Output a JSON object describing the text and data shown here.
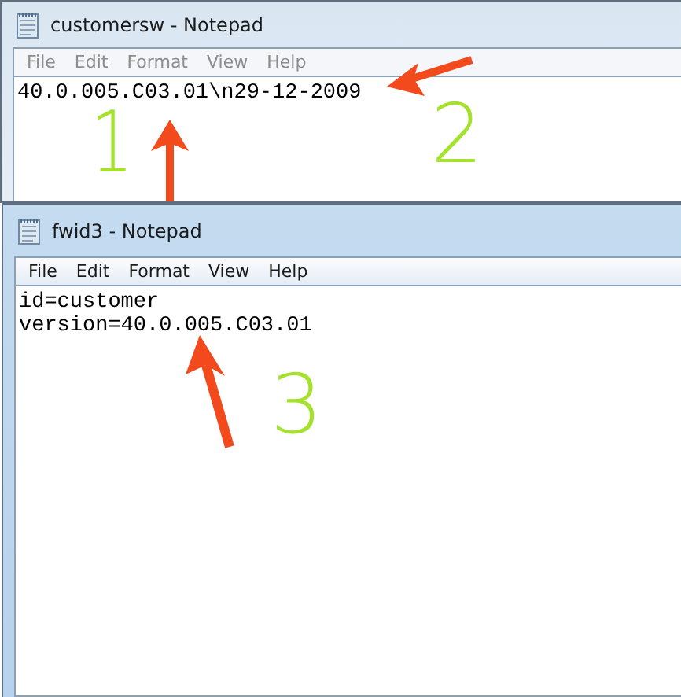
{
  "windows": [
    {
      "title": "customersw - Notepad",
      "active": false,
      "menu": [
        "File",
        "Edit",
        "Format",
        "View",
        "Help"
      ],
      "lines": [
        "40.0.005.C03.01\\n29-12-2009"
      ]
    },
    {
      "title": "fwid3 - Notepad",
      "active": true,
      "menu": [
        "File",
        "Edit",
        "Format",
        "View",
        "Help"
      ],
      "lines": [
        "id=customer",
        "version=40.0.005.C03.01"
      ]
    }
  ],
  "annotations": [
    {
      "text": "1"
    },
    {
      "text": "2"
    },
    {
      "text": "3"
    }
  ]
}
